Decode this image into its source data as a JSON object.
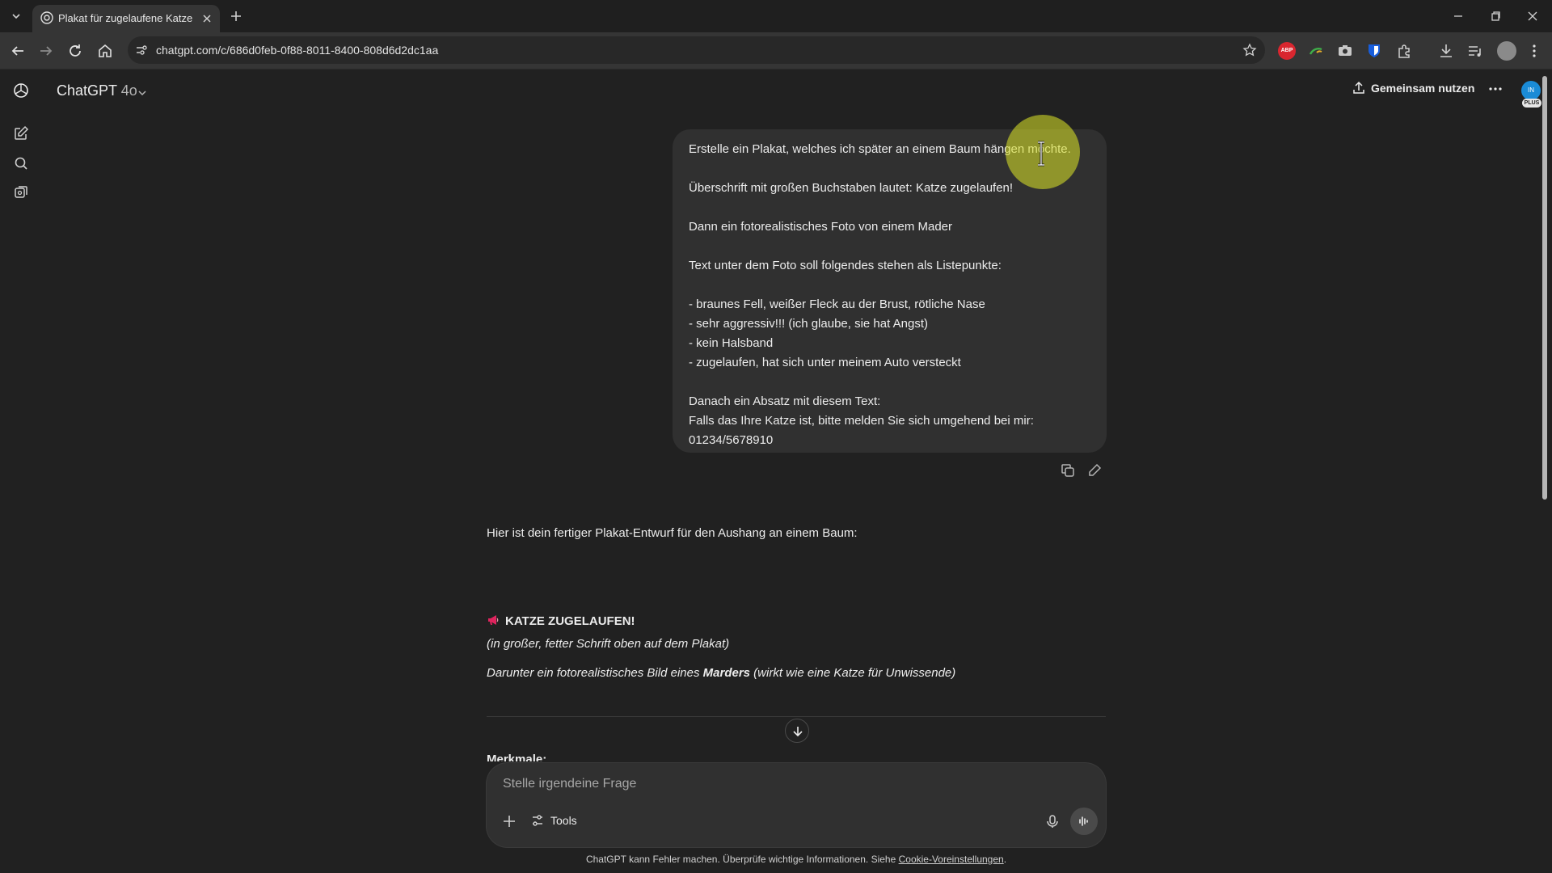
{
  "browser": {
    "tab_title": "Plakat für zugelaufene Katze",
    "url": "chatgpt.com/c/686d0feb-0f88-8011-8400-808d6d2dc1aa",
    "extensions": [
      "abp-icon",
      "extension-icon",
      "camera-icon",
      "bitwarden-icon",
      "puzzle-icon"
    ],
    "abp_label": "ABP"
  },
  "header": {
    "model_name": "ChatGPT",
    "model_version": "4o",
    "share_label": "Gemeinsam nutzen",
    "avatar_initials": "IN",
    "plan_badge": "PLUS"
  },
  "user_message": {
    "lines": [
      "Erstelle ein Plakat, welches ich später an einem Baum hängen möchte.",
      "",
      "Überschrift mit großen Buchstaben lautet: Katze zugelaufen!",
      "",
      "Dann ein fotorealistisches Foto von einem Mader",
      "",
      "Text unter dem Foto soll folgendes stehen als Listepunkte:",
      "",
      "- braunes Fell, weißer Fleck au der Brust, rötliche Nase",
      "- sehr aggressiv!!! (ich glaube, sie hat Angst)",
      "- kein Halsband",
      "- zugelaufen, hat sich unter meinem Auto versteckt",
      "",
      "Danach ein Absatz mit diesem Text:",
      "Falls das Ihre Katze ist, bitte melden Sie sich umgehend bei mir:",
      "01234/5678910"
    ]
  },
  "assistant_message": {
    "intro": "Hier ist dein fertiger Plakat-Entwurf für den Aushang an einem Baum:",
    "heading": "KATZE ZUGELAUFEN!",
    "note": "(in großer, fetter Schrift oben auf dem Plakat)",
    "desc_prefix": "Darunter ein fotorealistisches Bild eines ",
    "desc_bold": "Marders",
    "desc_suffix": " (wirkt wie eine Katze für Unwissende)",
    "next_heading": "Merkmale:"
  },
  "composer": {
    "placeholder": "Stelle irgendeine Frage",
    "tools_label": "Tools"
  },
  "footer": {
    "disclaimer": "ChatGPT kann Fehler machen. Überprüfe wichtige Informationen. Siehe ",
    "link": "Cookie-Voreinstellungen",
    "suffix": "."
  },
  "colors": {
    "background": "#212121",
    "bubble": "#303030",
    "cursor_highlight": "#d6de28",
    "avatar": "#1a8bd6"
  }
}
